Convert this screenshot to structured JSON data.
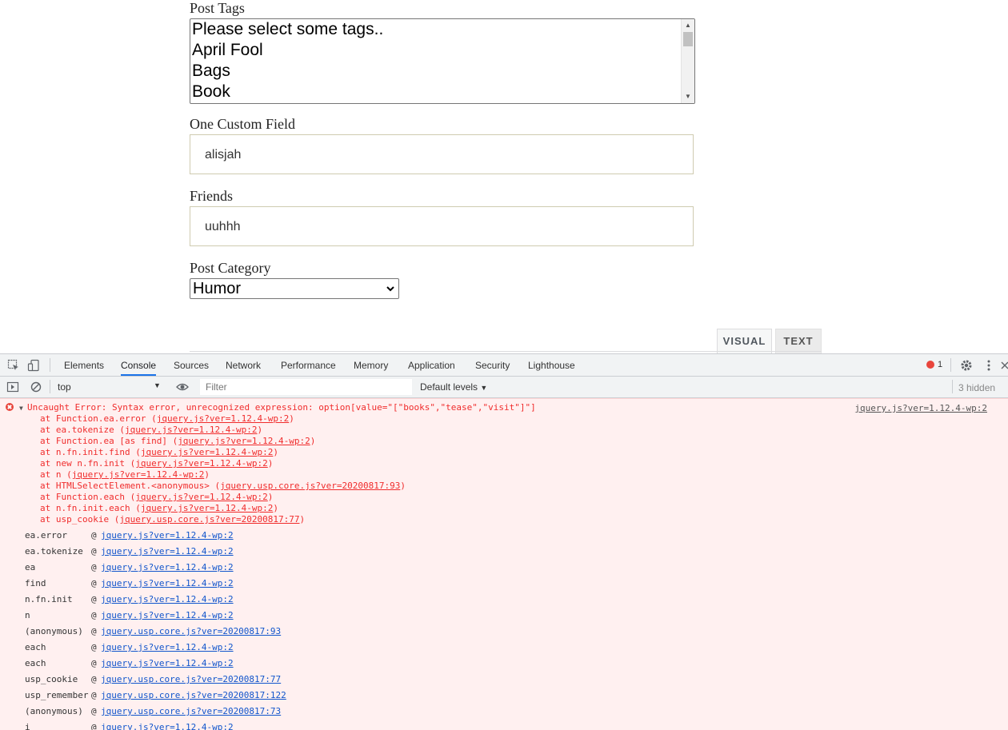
{
  "form": {
    "post_tags_label": "Post Tags",
    "tag_options": [
      "Please select some tags..",
      "April Fool",
      "Bags",
      "Book"
    ],
    "custom_field_label": "One Custom Field",
    "custom_field_value": "alisjah",
    "friends_label": "Friends",
    "friends_value": "uuhhh",
    "category_label": "Post Category",
    "category_value": "Humor"
  },
  "editor_tabs": {
    "visual": "VISUAL",
    "text": "TEXT"
  },
  "devtools": {
    "tabs": [
      "Elements",
      "Console",
      "Sources",
      "Network",
      "Performance",
      "Memory",
      "Application",
      "Security",
      "Lighthouse"
    ],
    "active_tab": "Console",
    "error_count": "1",
    "context": "top",
    "filter_placeholder": "Filter",
    "levels": "Default levels",
    "hidden": "3 hidden"
  },
  "console": {
    "error_message": "Uncaught Error: Syntax error, unrecognized expression: option[value=\"[\"books\",\"tease\",\"visit\"]\"]",
    "error_source": "jquery.js?ver=1.12.4-wp:2",
    "stack": [
      {
        "prefix": "at Function.ea.error (",
        "link": "jquery.js?ver=1.12.4-wp:2",
        "suffix": ")"
      },
      {
        "prefix": "at ea.tokenize (",
        "link": "jquery.js?ver=1.12.4-wp:2",
        "suffix": ")"
      },
      {
        "prefix": "at Function.ea [as find] (",
        "link": "jquery.js?ver=1.12.4-wp:2",
        "suffix": ")"
      },
      {
        "prefix": "at n.fn.init.find (",
        "link": "jquery.js?ver=1.12.4-wp:2",
        "suffix": ")"
      },
      {
        "prefix": "at new n.fn.init (",
        "link": "jquery.js?ver=1.12.4-wp:2",
        "suffix": ")"
      },
      {
        "prefix": "at n (",
        "link": "jquery.js?ver=1.12.4-wp:2",
        "suffix": ")"
      },
      {
        "prefix": "at HTMLSelectElement.<anonymous> (",
        "link": "jquery.usp.core.js?ver=20200817:93",
        "suffix": ")"
      },
      {
        "prefix": "at Function.each (",
        "link": "jquery.js?ver=1.12.4-wp:2",
        "suffix": ")"
      },
      {
        "prefix": "at n.fn.init.each (",
        "link": "jquery.js?ver=1.12.4-wp:2",
        "suffix": ")"
      },
      {
        "prefix": "at usp_cookie (",
        "link": "jquery.usp.core.js?ver=20200817:77",
        "suffix": ")"
      }
    ],
    "trace": [
      {
        "fn": "ea.error",
        "link": "jquery.js?ver=1.12.4-wp:2"
      },
      {
        "fn": "ea.tokenize",
        "link": "jquery.js?ver=1.12.4-wp:2"
      },
      {
        "fn": "ea",
        "link": "jquery.js?ver=1.12.4-wp:2"
      },
      {
        "fn": "find",
        "link": "jquery.js?ver=1.12.4-wp:2"
      },
      {
        "fn": "n.fn.init",
        "link": "jquery.js?ver=1.12.4-wp:2"
      },
      {
        "fn": "n",
        "link": "jquery.js?ver=1.12.4-wp:2"
      },
      {
        "fn": "(anonymous)",
        "link": "jquery.usp.core.js?ver=20200817:93"
      },
      {
        "fn": "each",
        "link": "jquery.js?ver=1.12.4-wp:2"
      },
      {
        "fn": "each",
        "link": "jquery.js?ver=1.12.4-wp:2"
      },
      {
        "fn": "usp_cookie",
        "link": "jquery.usp.core.js?ver=20200817:77"
      },
      {
        "fn": "usp_remember",
        "link": "jquery.usp.core.js?ver=20200817:122"
      },
      {
        "fn": "(anonymous)",
        "link": "jquery.usp.core.js?ver=20200817:73"
      },
      {
        "fn": "i",
        "link": "jquery.js?ver=1.12.4-wp:2"
      }
    ]
  }
}
